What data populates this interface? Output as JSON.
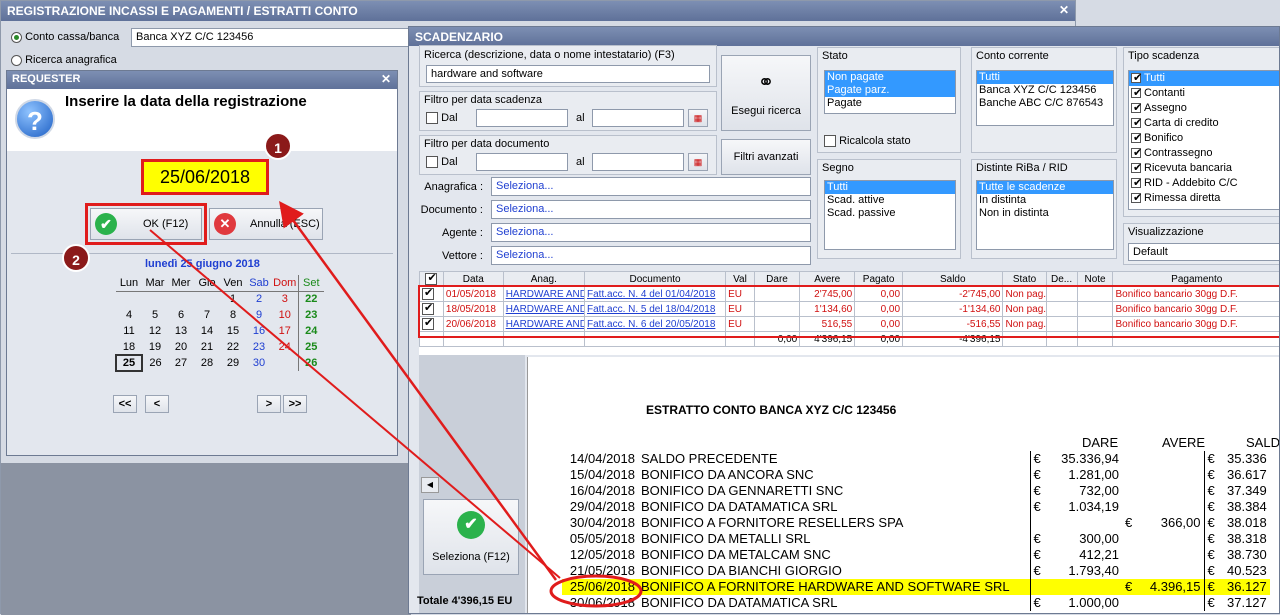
{
  "main_window": {
    "title": "REGISTRAZIONE INCASSI E PAGAMENTI / ESTRATTI CONTO",
    "radio1": "Conto cassa/banca",
    "radio1_value": "Banca XYZ C/C 123456",
    "radio2": "Ricerca anagrafica"
  },
  "requester": {
    "title": "REQUESTER",
    "prompt": "Inserire la data della registrazione",
    "date_value": "25/06/2018",
    "ok_label": "OK (F12)",
    "cancel_label": "Annulla (ESC)",
    "calendar": {
      "header": "lunedì 25 giugno 2018",
      "days": [
        "Lun",
        "Mar",
        "Mer",
        "Gio",
        "Ven",
        "Sab",
        "Dom"
      ],
      "week_label": "Set",
      "rows": [
        [
          "",
          "",
          "",
          "",
          "1",
          "2",
          "3",
          "22"
        ],
        [
          "4",
          "5",
          "6",
          "7",
          "8",
          "9",
          "10",
          "23"
        ],
        [
          "11",
          "12",
          "13",
          "14",
          "15",
          "16",
          "17",
          "24"
        ],
        [
          "18",
          "19",
          "20",
          "21",
          "22",
          "23",
          "24",
          "25"
        ],
        [
          "25",
          "26",
          "27",
          "28",
          "29",
          "30",
          "",
          "26"
        ]
      ],
      "nav": [
        "<<",
        "<",
        ">",
        ">>"
      ]
    }
  },
  "callouts": {
    "one": "1",
    "two": "2"
  },
  "scadenzario": {
    "title": "SCADENZARIO",
    "search_label": "Ricerca (descrizione, data o nome intestatario) (F3)",
    "search_value": "hardware and software",
    "filter_scad": "Filtro per data scadenza",
    "filter_doc": "Filtro per data documento",
    "dal": "Dal",
    "al": "al",
    "search_btn": "Esegui ricerca",
    "adv_btn": "Filtri avanzati",
    "stato": {
      "title": "Stato",
      "items": [
        "Non pagate",
        "Pagate parz.",
        "Pagate"
      ],
      "recalc": "Ricalcola stato"
    },
    "conto": {
      "title": "Conto corrente",
      "items": [
        "Tutti",
        "Banca XYZ C/C 123456",
        "Banche ABC C/C 876543"
      ]
    },
    "tipo": {
      "title": "Tipo scadenza",
      "items": [
        "Tutti",
        "Contanti",
        "Assegno",
        "Carta di credito",
        "Bonifico",
        "Contrassegno",
        "Ricevuta bancaria",
        "RID - Addebito C/C",
        "Rimessa diretta"
      ]
    },
    "segno": {
      "title": "Segno",
      "items": [
        "Tutti",
        "Scad. attive",
        "Scad. passive"
      ]
    },
    "distinte": {
      "title": "Distinte RiBa / RID",
      "items": [
        "Tutte le scadenze",
        "In distinta",
        "Non in distinta"
      ]
    },
    "visual": {
      "title": "Visualizzazione",
      "value": "Default"
    },
    "fields": [
      {
        "label": "Anagrafica :",
        "value": "Seleziona..."
      },
      {
        "label": "Documento :",
        "value": "Seleziona..."
      },
      {
        "label": "Agente :",
        "value": "Seleziona..."
      },
      {
        "label": "Vettore :",
        "value": "Seleziona..."
      }
    ],
    "table": {
      "headers": [
        "Data",
        "Anag.",
        "Documento",
        "Val",
        "Dare",
        "Avere",
        "Pagato",
        "Saldo",
        "Stato",
        "De...",
        "Note",
        "Pagamento"
      ],
      "rows": [
        [
          "01/05/2018",
          "HARDWARE AND SO...",
          "Fatt.acc. N. 4 del 01/04/2018",
          "EU",
          "",
          "2'745,00",
          "0,00",
          "-2'745,00",
          "Non pag.",
          "",
          "",
          "Bonifico bancario 30gg D.F."
        ],
        [
          "18/05/2018",
          "HARDWARE AND SO...",
          "Fatt.acc. N. 5 del 18/04/2018",
          "EU",
          "",
          "1'134,60",
          "0,00",
          "-1'134,60",
          "Non pag.",
          "",
          "",
          "Bonifico bancario 30gg D.F."
        ],
        [
          "20/06/2018",
          "HARDWARE AND SO...",
          "Fatt.acc. N. 6 del 20/05/2018",
          "EU",
          "",
          "516,55",
          "0,00",
          "-516,55",
          "Non pag.",
          "",
          "",
          "Bonifico bancario 30gg D.F."
        ]
      ],
      "totals": [
        "0,00",
        "4'396,15",
        "0,00",
        "-4'396,15"
      ]
    },
    "select_btn": "Seleziona (F12)",
    "total_label": "Totale 4'396,15 EU"
  },
  "estratto": {
    "title": "ESTRATTO CONTO BANCA XYZ C/C 123456",
    "col_dare": "DARE",
    "col_avere": "AVERE",
    "col_saldo": "SALD",
    "rows": [
      {
        "date": "14/04/2018",
        "desc": "SALDO PRECEDENTE",
        "dare": "35.336,94",
        "avere": "",
        "saldo": "35.336"
      },
      {
        "date": "15/04/2018",
        "desc": "BONIFICO DA ANCORA SNC",
        "dare": "1.281,00",
        "avere": "",
        "saldo": "36.617"
      },
      {
        "date": "16/04/2018",
        "desc": "BONIFICO DA GENNARETTI SNC",
        "dare": "732,00",
        "avere": "",
        "saldo": "37.349"
      },
      {
        "date": "29/04/2018",
        "desc": "BONIFICO DA DATAMATICA SRL",
        "dare": "1.034,19",
        "avere": "",
        "saldo": "38.384"
      },
      {
        "date": "30/04/2018",
        "desc": "BONIFICO A FORNITORE RESELLERS SPA",
        "dare": "",
        "avere": "366,00",
        "saldo": "38.018"
      },
      {
        "date": "05/05/2018",
        "desc": "BONIFICO DA METALLI SRL",
        "dare": "300,00",
        "avere": "",
        "saldo": "38.318"
      },
      {
        "date": "12/05/2018",
        "desc": "BONIFICO DA METALCAM SNC",
        "dare": "412,21",
        "avere": "",
        "saldo": "38.730"
      },
      {
        "date": "21/05/2018",
        "desc": "BONIFICO DA BIANCHI GIORGIO",
        "dare": "1.793,40",
        "avere": "",
        "saldo": "40.523"
      },
      {
        "date": "25/06/2018",
        "desc": "BONIFICO A FORNITORE HARDWARE AND SOFTWARE SRL",
        "dare": "",
        "avere": "4.396,15",
        "saldo": "36.127"
      },
      {
        "date": "30/06/2018",
        "desc": "BONIFICO DA DATAMATICA SRL",
        "dare": "1.000,00",
        "avere": "",
        "saldo": "37.127"
      }
    ],
    "currency": "€"
  }
}
